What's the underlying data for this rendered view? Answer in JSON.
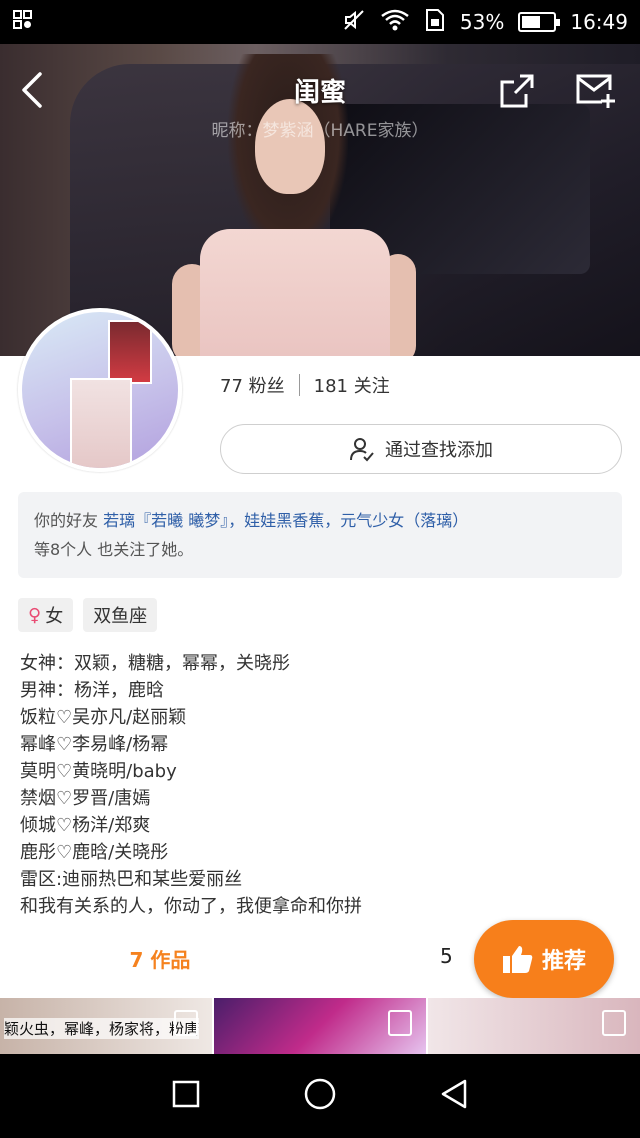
{
  "status_bar": {
    "left_icon": "app-notification-icon",
    "battery": "53%",
    "battery_level": 0.53,
    "time": "16:49"
  },
  "header": {
    "title": "闺蜜",
    "nickname": "昵称：梦紫涵（HARE家族）"
  },
  "stats": {
    "fans": "77 粉丝",
    "following": "181 关注"
  },
  "add_button": "通过查找添加",
  "mutual": {
    "prefix": "你的好友",
    "friends": "若璃『若曦 曦梦』，娃娃黑香蕉，元气少女（落璃）",
    "suffix": "等8个人 也关注了她。"
  },
  "tags": {
    "gender": "女",
    "zodiac": "双鱼座"
  },
  "bio": [
    "女神：双颖，糖糖，幂幂，关晓彤",
    "男神：杨洋，鹿晗",
    "饭粒♡吴亦凡/赵丽颖",
    "幂峰♡李易峰/杨幂",
    "莫明♡黄晓明/baby",
    "禁烟♡罗晋/唐嫣",
    "倾城♡杨洋/郑爽",
    "鹿彤♡鹿晗/关晓彤",
    "雷区:迪丽热巴和某些爱丽丝",
    "和我有关系的人，你动了，我便拿命和你拼"
  ],
  "tabs": {
    "works": "7 作品",
    "other": "5"
  },
  "recommend": "推荐",
  "thumbs": [
    {
      "caption": "颖火虫，幂峰，杨家将，粉唐"
    }
  ]
}
